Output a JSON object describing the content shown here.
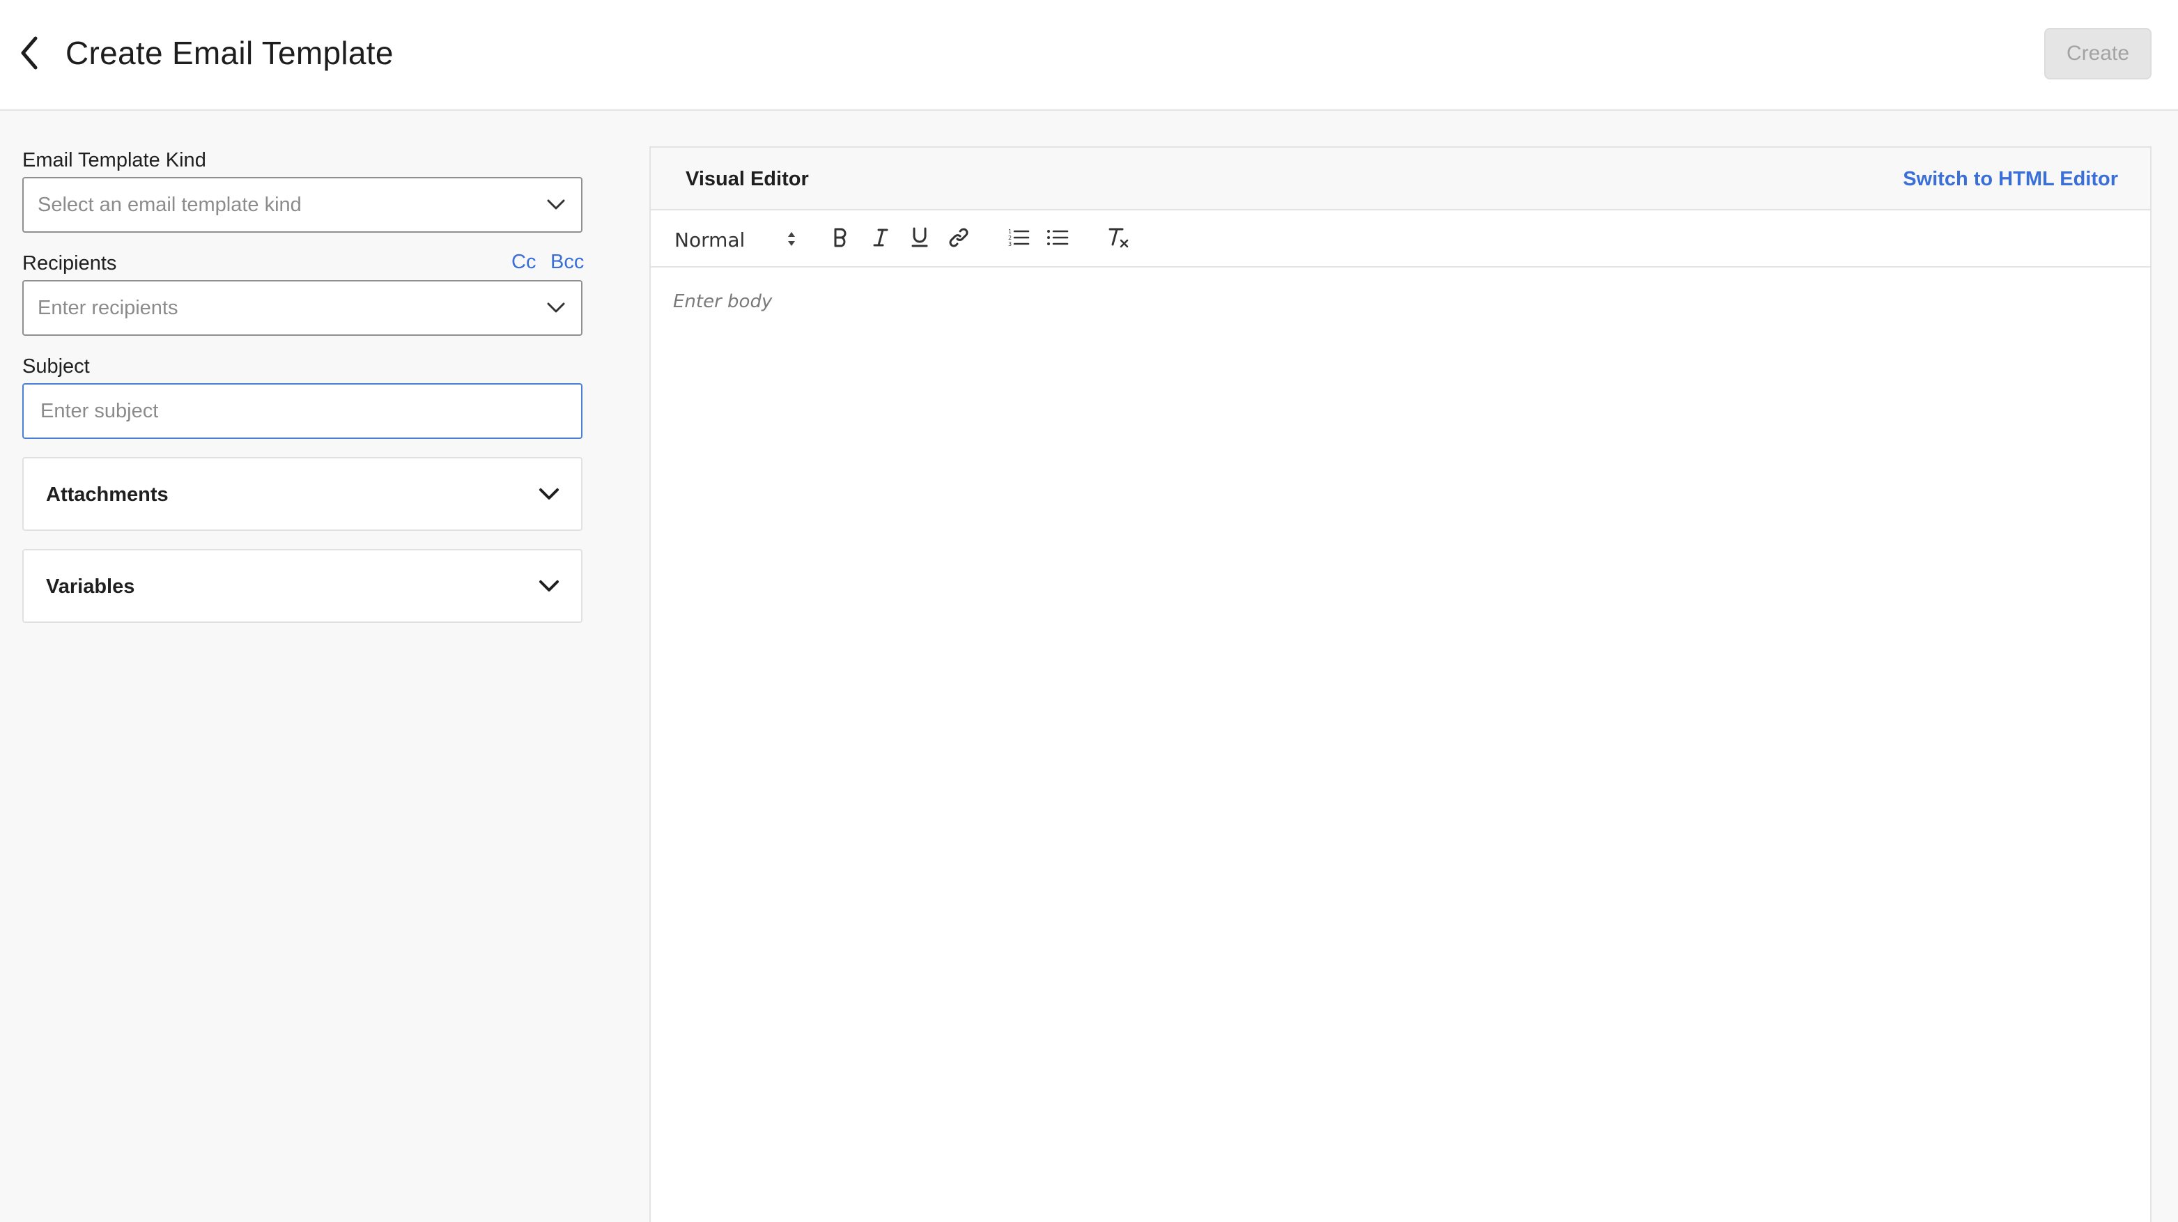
{
  "header": {
    "title": "Create Email Template",
    "create_label": "Create"
  },
  "form": {
    "template_kind": {
      "label": "Email Template Kind",
      "placeholder": "Select an email template kind"
    },
    "recipients": {
      "label": "Recipients",
      "placeholder": "Enter recipients",
      "cc_label": "Cc",
      "bcc_label": "Bcc"
    },
    "subject": {
      "label": "Subject",
      "placeholder": "Enter subject",
      "value": ""
    },
    "attachments_label": "Attachments",
    "variables_label": "Variables"
  },
  "editor": {
    "title": "Visual Editor",
    "switch_label": "Switch to HTML Editor",
    "format_value": "Normal",
    "body_placeholder": "Enter body",
    "toolbar_icons": [
      "bold-icon",
      "italic-icon",
      "underline-icon",
      "link-icon",
      "ordered-list-icon",
      "bullet-list-icon",
      "clear-format-icon"
    ]
  },
  "colors": {
    "accent": "#3a6fd8",
    "focus_border": "#4a7fd6",
    "disabled_button": "#e5e5e5",
    "background": "#f8f8f8"
  }
}
